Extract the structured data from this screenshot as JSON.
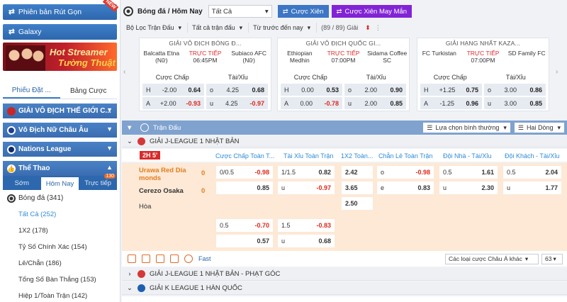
{
  "sidebar": {
    "lite_button": "Phiên bản Rút Gọn",
    "new_badge": "NEW",
    "galaxy_button": "Galaxy",
    "banner_line1": "Hot Streamer",
    "banner_line2": "Tường Thuật",
    "ticket_tabs": [
      "Phiếu Đặt ...",
      "Bảng Cược"
    ],
    "sections": [
      "GIẢI VÔ ĐỊCH THẾ GIỚI C...",
      "Vô Địch Nữ Châu Âu",
      "Nations League",
      "Thể Thao"
    ],
    "sport_tabs": [
      "Sớm",
      "Hôm Nay",
      "Trực tiếp"
    ],
    "live_count": "130",
    "sport_head": "Bóng đá (341)",
    "items": [
      "Tất Cả (252)",
      "1X2 (178)",
      "Tỷ Số Chính Xác (154)",
      "Lẻ/Chẵn (186)",
      "Tổng Số Bàn Thắng (153)",
      "Hiệp 1/Toàn Trận (142)"
    ]
  },
  "topbar": {
    "title": "Bóng đá / Hôm Nay",
    "select": "Tất Cả",
    "parlay": "Cược Xiên",
    "lucky_parlay": "Cược Xiên May Mắn"
  },
  "filters": {
    "league": "Bộ Lọc Trận Đấu",
    "all_matches": "Tất cả trận đấu",
    "order": "Từ trước đến nay",
    "count": "(89 / 89) Giải"
  },
  "cards": [
    {
      "league": "GIẢI VÔ ĐỊCH BÓNG Đ...",
      "home": "Balcatta Etna (Nữ)",
      "away": "Subiaco AFC (Nữ)",
      "live": "TRỰC TIẾP",
      "time": "06:45PM",
      "h_label": "Cược Chấp",
      "ou_label": "Tài/Xỉu",
      "rows": [
        [
          "H",
          "-2.00",
          "0.64",
          "o",
          "4.25",
          "0.68"
        ],
        [
          "A",
          "+2.00",
          "-0.93",
          "u",
          "4.25",
          "-0.97"
        ]
      ]
    },
    {
      "league": "GIẢI VÔ ĐỊCH QUỐC GI...",
      "home": "Ethiopian Medhin",
      "away": "Sidama Coffee SC",
      "live": "TRỰC TIẾP",
      "time": "07:00PM",
      "h_label": "Cược Chấp",
      "ou_label": "Tài/Xỉu",
      "rows": [
        [
          "H",
          "0.00",
          "0.53",
          "o",
          "2.00",
          "0.90"
        ],
        [
          "A",
          "0.00",
          "-0.78",
          "u",
          "2.00",
          "0.85"
        ]
      ]
    },
    {
      "league": "GIẢI HẠNG NHẤT KAZA...",
      "home": "FC Turkistan",
      "away": "SD Family FC",
      "live": "TRỰC TIẾP",
      "time": "07:00PM",
      "h_label": "Cược Chấp",
      "ou_label": "Tài/Xỉu",
      "rows": [
        [
          "H",
          "+1.25",
          "0.75",
          "o",
          "3.00",
          "0.86"
        ],
        [
          "A",
          "-1.25",
          "0.96",
          "u",
          "3.00",
          "0.85"
        ]
      ]
    }
  ],
  "matches_panel": {
    "title": "Trận Đấu",
    "sort": "Lựa chọn bình thường",
    "lines": "Hai Dòng"
  },
  "leagues": [
    "GIẢI J-LEAGUE 1 NHẬT BẢN",
    "GIẢI J-LEAGUE 1 NHẬT BẢN - PHẠT GÓC",
    "GIẢI K LEAGUE 1 HÀN QUỐC"
  ],
  "columns": [
    "Cược Chấp Toàn T...",
    "Tài Xỉu Toàn Trận",
    "1X2 Toàn...",
    "Chẵn Lẻ Toàn Trận",
    "Đội Nhà - Tài/Xỉu",
    "Đội Khách - Tài/Xỉu"
  ],
  "match": {
    "status": "2H 5'",
    "home": "Urawa Red Dia monds",
    "away": "Cerezo Osaka",
    "draw": "Hòa",
    "home_score": "0",
    "away_score": "0",
    "odds": {
      "hdp_line": "0/0.5",
      "hdp_home": "-0.98",
      "hdp_away": "0.85",
      "ou_line": "1/1.5",
      "ou_over": "0.82",
      "ou_u": "u",
      "ou_under": "-0.97",
      "x1": "2.42",
      "x2": "3.65",
      "xd": "2.50",
      "oe_o": "o",
      "oe_o_val": "-0.98",
      "oe_e": "e",
      "oe_e_val": "0.83",
      "hou_line": "0.5",
      "hou_over": "1.61",
      "hou_u": "u",
      "hou_under": "2.30",
      "aou_line": "0.5",
      "aou_over": "2.04",
      "aou_u": "u",
      "aou_under": "1.77",
      "h1_line": "0.5",
      "h1_home": "-0.70",
      "h1_away": "0.57",
      "h1_ou_line": "1.5",
      "h1_over": "-0.83",
      "h1_u": "u",
      "h1_under": "0.68"
    }
  },
  "toolbar": {
    "fast": "Fast",
    "odds_type": "Các loại cược Châu Á khác",
    "page_size": "63"
  }
}
